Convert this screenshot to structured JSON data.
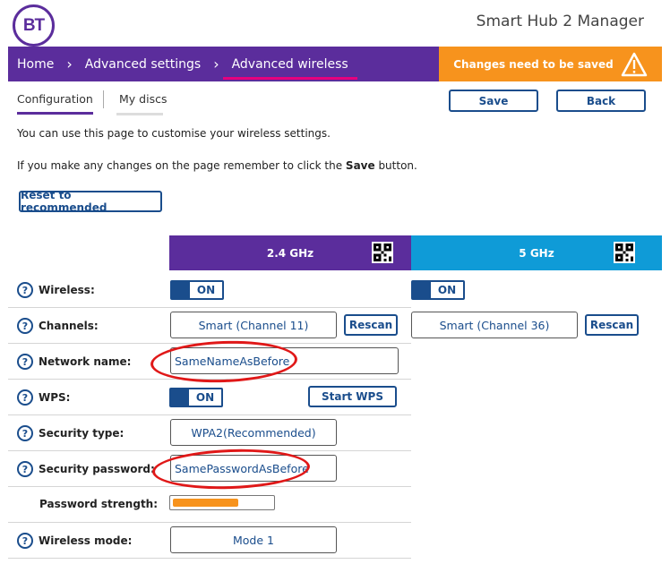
{
  "header": {
    "logo_text": "BT",
    "app_title": "Smart Hub 2 Manager"
  },
  "nav": {
    "items": [
      {
        "label": "Home"
      },
      {
        "label": "Advanced settings"
      },
      {
        "label": "Advanced wireless"
      }
    ],
    "changes_notice": "Changes need to be saved"
  },
  "tabs": [
    {
      "label": "Configuration"
    },
    {
      "label": "My discs"
    }
  ],
  "toolbar": {
    "save_label": "Save",
    "back_label": "Back"
  },
  "intro": {
    "line1": "You can use this page to customise your wireless settings.",
    "line2_prefix": "If you make any changes on the page remember to click the ",
    "line2_bold": "Save",
    "line2_suffix": " button."
  },
  "reset_label": "Reset to recommended",
  "bands": {
    "band24": "2.4 GHz",
    "band5": "5 GHz"
  },
  "rows": {
    "wireless": "Wireless:",
    "channels": "Channels:",
    "network_name": "Network name:",
    "wps": "WPS:",
    "security_type": "Security type:",
    "security_password": "Security password:",
    "password_strength": "Password strength:",
    "wireless_mode": "Wireless mode:"
  },
  "values": {
    "wireless24": "ON",
    "wireless5": "ON",
    "channel24": "Smart (Channel 11)",
    "channel5": "Smart (Channel 36)",
    "rescan_label": "Rescan",
    "network_name": "SameNameAsBefore",
    "wps": "ON",
    "start_wps_label": "Start WPS",
    "security_type": "WPA2(Recommended)",
    "security_password": "SamePasswordAsBefore",
    "password_strength_fraction": 0.66,
    "wireless_mode": "Mode 1"
  },
  "help_glyph": "?",
  "colors": {
    "brand_purple": "#5b2d9c",
    "band5_blue": "#0f9bd7",
    "warning_orange": "#f7931d",
    "link_blue": "#1a4d8c",
    "annotation_red": "#e01818"
  }
}
